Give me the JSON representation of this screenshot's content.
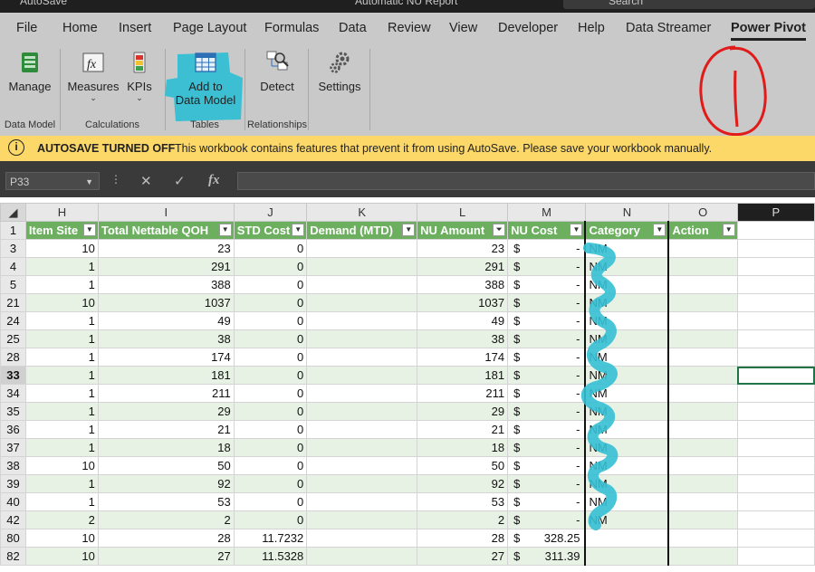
{
  "titlebar": {
    "autosave": "AutoSave",
    "doc_title": "Automatic NU Report",
    "search_placeholder": "Search"
  },
  "tabs": [
    {
      "label": "File"
    },
    {
      "label": "Home"
    },
    {
      "label": "Insert"
    },
    {
      "label": "Page Layout"
    },
    {
      "label": "Formulas"
    },
    {
      "label": "Data"
    },
    {
      "label": "Review"
    },
    {
      "label": "View"
    },
    {
      "label": "Developer"
    },
    {
      "label": "Help"
    },
    {
      "label": "Data Streamer"
    },
    {
      "label": "Power Pivot",
      "active": true
    }
  ],
  "ribbon": {
    "manage": "Manage",
    "measures": "Measures",
    "kpis": "KPIs",
    "add_to_data_model": [
      "Add to",
      "Data Model"
    ],
    "detect": "Detect",
    "settings": "Settings",
    "groups": {
      "data_model": "Data Model",
      "calculations": "Calculations",
      "tables": "Tables",
      "relationships": "Relationships"
    }
  },
  "infobar": {
    "title": "AUTOSAVE TURNED OFF",
    "message": "This workbook contains features that prevent it from using AutoSave. Please save your workbook manually."
  },
  "formula_bar": {
    "name_box": "P33",
    "cancel": "✕",
    "enter": "✓",
    "fx": "fx",
    "formula": ""
  },
  "sheet": {
    "columns": [
      "H",
      "I",
      "J",
      "K",
      "L",
      "M",
      "N",
      "O",
      "P"
    ],
    "header_row_num": "1",
    "headers": [
      "Item Site",
      "Total Nettable QOH",
      "STD Cost",
      "Demand (MTD)",
      "NU Amount",
      "NU Cost",
      "Category",
      "Action"
    ],
    "currency_symbol": "$",
    "rows": [
      {
        "row": "3",
        "site": "10",
        "qoh": "23",
        "std": "0",
        "demand": "",
        "nu": "23",
        "cost": "-",
        "cat": "NM"
      },
      {
        "row": "4",
        "site": "1",
        "qoh": "291",
        "std": "0",
        "demand": "",
        "nu": "291",
        "cost": "-",
        "cat": "NM"
      },
      {
        "row": "5",
        "site": "1",
        "qoh": "388",
        "std": "0",
        "demand": "",
        "nu": "388",
        "cost": "-",
        "cat": "NM"
      },
      {
        "row": "21",
        "site": "10",
        "qoh": "1037",
        "std": "0",
        "demand": "",
        "nu": "1037",
        "cost": "-",
        "cat": "NM"
      },
      {
        "row": "24",
        "site": "1",
        "qoh": "49",
        "std": "0",
        "demand": "",
        "nu": "49",
        "cost": "-",
        "cat": "NM"
      },
      {
        "row": "25",
        "site": "1",
        "qoh": "38",
        "std": "0",
        "demand": "",
        "nu": "38",
        "cost": "-",
        "cat": "NM"
      },
      {
        "row": "28",
        "site": "1",
        "qoh": "174",
        "std": "0",
        "demand": "",
        "nu": "174",
        "cost": "-",
        "cat": "NM"
      },
      {
        "row": "33",
        "site": "1",
        "qoh": "181",
        "std": "0",
        "demand": "",
        "nu": "181",
        "cost": "-",
        "cat": "NM",
        "active": true
      },
      {
        "row": "34",
        "site": "1",
        "qoh": "211",
        "std": "0",
        "demand": "",
        "nu": "211",
        "cost": "-",
        "cat": "NM"
      },
      {
        "row": "35",
        "site": "1",
        "qoh": "29",
        "std": "0",
        "demand": "",
        "nu": "29",
        "cost": "-",
        "cat": "NM"
      },
      {
        "row": "36",
        "site": "1",
        "qoh": "21",
        "std": "0",
        "demand": "",
        "nu": "21",
        "cost": "-",
        "cat": "NM"
      },
      {
        "row": "37",
        "site": "1",
        "qoh": "18",
        "std": "0",
        "demand": "",
        "nu": "18",
        "cost": "-",
        "cat": "NM"
      },
      {
        "row": "38",
        "site": "10",
        "qoh": "50",
        "std": "0",
        "demand": "",
        "nu": "50",
        "cost": "-",
        "cat": "NM"
      },
      {
        "row": "39",
        "site": "1",
        "qoh": "92",
        "std": "0",
        "demand": "",
        "nu": "92",
        "cost": "-",
        "cat": "NM"
      },
      {
        "row": "40",
        "site": "1",
        "qoh": "53",
        "std": "0",
        "demand": "",
        "nu": "53",
        "cost": "-",
        "cat": "NM"
      },
      {
        "row": "42",
        "site": "2",
        "qoh": "2",
        "std": "0",
        "demand": "",
        "nu": "2",
        "cost": "-",
        "cat": "NM"
      },
      {
        "row": "80",
        "site": "10",
        "qoh": "28",
        "std": "11.7232",
        "demand": "",
        "nu": "28",
        "cost": "328.25",
        "cat": ""
      },
      {
        "row": "82",
        "site": "10",
        "qoh": "27",
        "std": "11.5328",
        "demand": "",
        "nu": "27",
        "cost": "311.39",
        "cat": ""
      }
    ]
  },
  "colors": {
    "header_green": "#6cb05f",
    "band_green": "#e8f2e4",
    "info_yellow": "#fcd868",
    "highlight_cyan": "#35bfd4",
    "annotation_red": "#e11a1a"
  }
}
